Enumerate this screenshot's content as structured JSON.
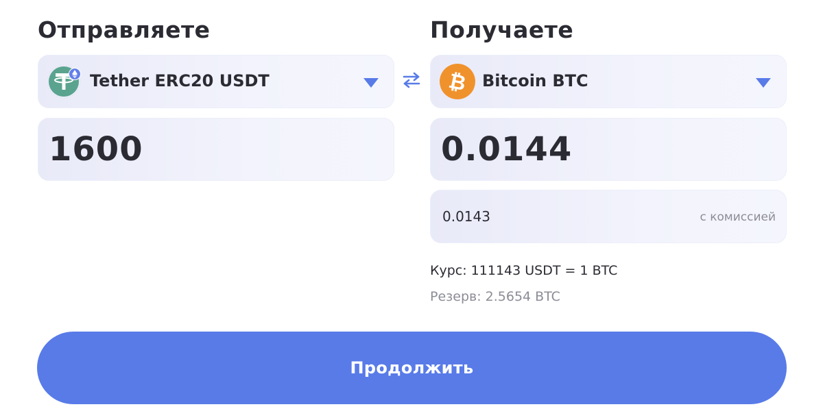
{
  "send": {
    "title": "Отправляете",
    "currency": {
      "name": "Tether ERC20 USDT",
      "icon": "tether-icon",
      "color": "#5aa48f",
      "network_icon": "ethereum-icon"
    },
    "amount": "1600"
  },
  "receive": {
    "title": "Получаете",
    "currency": {
      "name": "Bitcoin BTC",
      "icon": "bitcoin-icon",
      "color": "#f0922b"
    },
    "amount": "0.0144",
    "amount_with_fee": "0.0143",
    "fee_label": "с комиссией",
    "rate": "Курс: 111143 USDT = 1 BTC",
    "reserve": "Резерв: 2.5654 BTC"
  },
  "swap_icon": "swap-arrows-icon",
  "caret_icon": "triangle-down-icon",
  "continue_label": "Продолжить",
  "colors": {
    "accent": "#587be8",
    "text": "#2b2b33",
    "muted": "#8c8c96"
  }
}
